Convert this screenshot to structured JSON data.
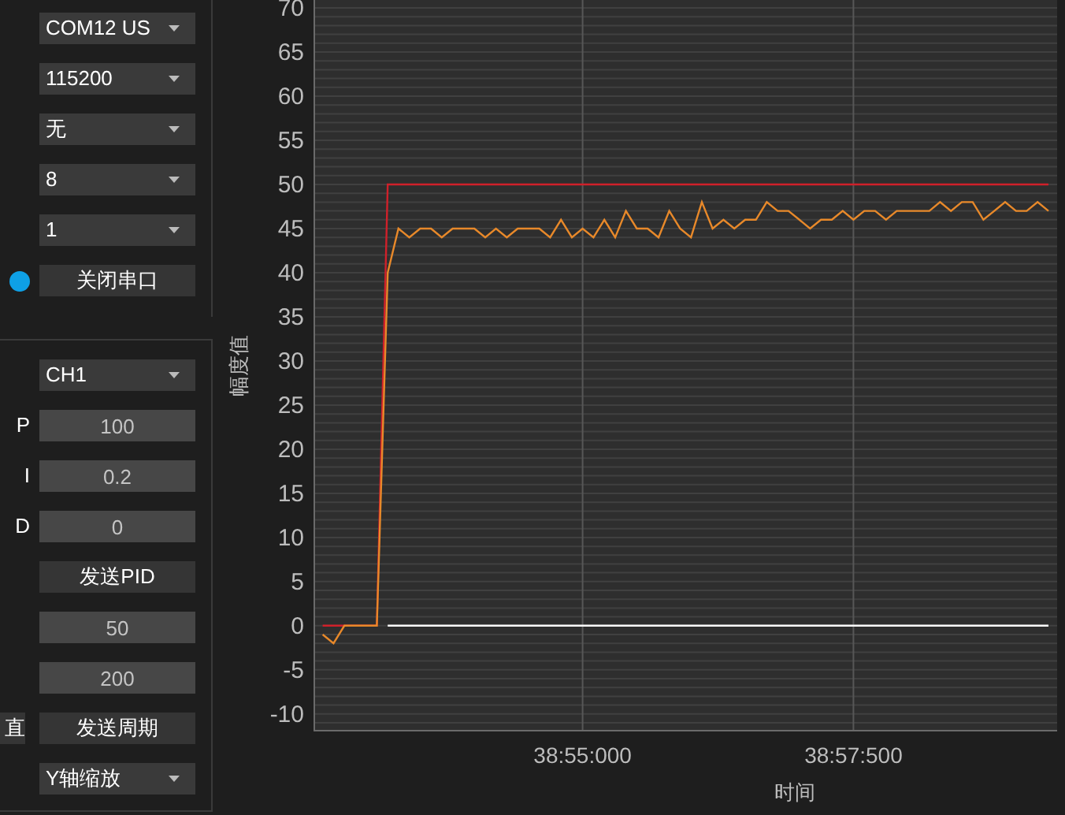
{
  "serial": {
    "controls": [
      {
        "kind": "dropdown",
        "value": "COM12 US"
      },
      {
        "kind": "dropdown",
        "value": "115200"
      },
      {
        "kind": "dropdown",
        "value": "无"
      },
      {
        "kind": "dropdown",
        "value": "8"
      },
      {
        "kind": "dropdown",
        "value": "1"
      }
    ],
    "connected": true,
    "toggle_button": "关闭串口"
  },
  "pid": {
    "channel": "CH1",
    "params": [
      {
        "label": "P",
        "value": "100"
      },
      {
        "label": "I",
        "value": "0.2"
      },
      {
        "label": "D",
        "value": "0"
      }
    ],
    "send_pid_button": "发送PID",
    "period_inputs": [
      "50",
      "200"
    ],
    "side_button": "直",
    "send_period_button": "发送周期",
    "zoom_dropdown": "Y轴缩放"
  },
  "chart": {
    "chart_data": {
      "type": "line",
      "xlabel": "时间",
      "ylabel": "幅度值",
      "categories": [
        null,
        null,
        null,
        null,
        null,
        null,
        null,
        null,
        null,
        null,
        null,
        null,
        null,
        null,
        null,
        null,
        null,
        null,
        null,
        null,
        null,
        null,
        null,
        null,
        "38:55:000",
        null,
        null,
        null,
        null,
        null,
        null,
        null,
        null,
        null,
        null,
        null,
        null,
        null,
        null,
        null,
        null,
        null,
        null,
        null,
        null,
        null,
        null,
        null,
        null,
        "38:57:500",
        null,
        null,
        null,
        null,
        null,
        null,
        null,
        null,
        null,
        null,
        null,
        null,
        null,
        null,
        null,
        null,
        null,
        null
      ],
      "series": [
        {
          "color": "#ffffff",
          "values": [
            null,
            null,
            null,
            null,
            null,
            null,
            0,
            0,
            0,
            0,
            0,
            0,
            0,
            0,
            0,
            0,
            0,
            0,
            0,
            0,
            0,
            0,
            0,
            0,
            0,
            0,
            0,
            0,
            0,
            0,
            0,
            0,
            0,
            0,
            0,
            0,
            0,
            0,
            0,
            0,
            0,
            0,
            0,
            0,
            0,
            0,
            0,
            0,
            0,
            0,
            0,
            0,
            0,
            0,
            0,
            0,
            0,
            0,
            0,
            0,
            0,
            0,
            0,
            0,
            0,
            0,
            0,
            0
          ]
        },
        {
          "color": "#d0202a",
          "values": [
            0,
            0,
            0,
            0,
            0,
            0,
            50,
            50,
            50,
            50,
            50,
            50,
            50,
            50,
            50,
            50,
            50,
            50,
            50,
            50,
            50,
            50,
            50,
            50,
            50,
            50,
            50,
            50,
            50,
            50,
            50,
            50,
            50,
            50,
            50,
            50,
            50,
            50,
            50,
            50,
            50,
            50,
            50,
            50,
            50,
            50,
            50,
            50,
            50,
            50,
            50,
            50,
            50,
            50,
            50,
            50,
            50,
            50,
            50,
            50,
            50,
            50,
            50,
            50,
            50,
            50,
            50,
            50
          ]
        },
        {
          "color": "#e8892a",
          "values": [
            -1,
            -2,
            0,
            0,
            0,
            0,
            40,
            45,
            44,
            45,
            45,
            44,
            45,
            45,
            45,
            44,
            45,
            44,
            45,
            45,
            45,
            44,
            46,
            44,
            45,
            44,
            46,
            44,
            47,
            45,
            45,
            44,
            47,
            45,
            44,
            48,
            45,
            46,
            45,
            46,
            46,
            48,
            47,
            47,
            46,
            45,
            46,
            46,
            47,
            46,
            47,
            47,
            46,
            47,
            47,
            47,
            47,
            48,
            47,
            48,
            48,
            46,
            47,
            48,
            47,
            47,
            48,
            47
          ]
        }
      ],
      "ylim": [
        -11.8,
        70.9
      ],
      "grid": true,
      "yticks": [
        -10,
        -5,
        0,
        5,
        10,
        15,
        20,
        25,
        30,
        35,
        40,
        45,
        50,
        55,
        60,
        65,
        70
      ]
    }
  }
}
